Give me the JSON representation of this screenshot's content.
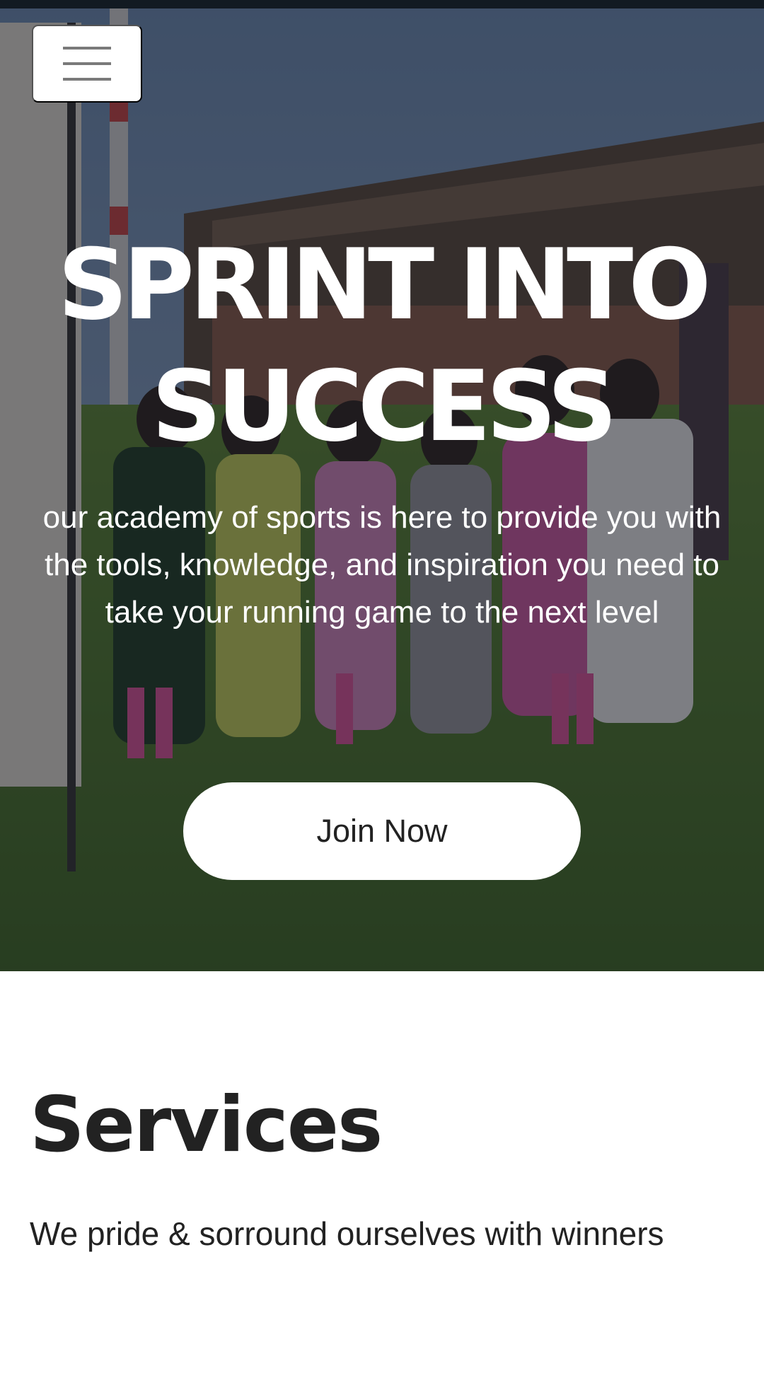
{
  "hero": {
    "menu_icon": "hamburger-menu-icon",
    "title_line1": "SPRINT INTO",
    "title_line2": "SUCCESS",
    "subtitle": "our academy of sports is here to provide you with the tools, knowledge, and inspiration you need to take your running game to the next level",
    "cta_label": "Join Now"
  },
  "services": {
    "heading": "Services",
    "tagline": "We pride & sorround ourselves with winners"
  },
  "colors": {
    "text_dark": "#222222",
    "white": "#ffffff",
    "status_strip": "#121a22"
  }
}
